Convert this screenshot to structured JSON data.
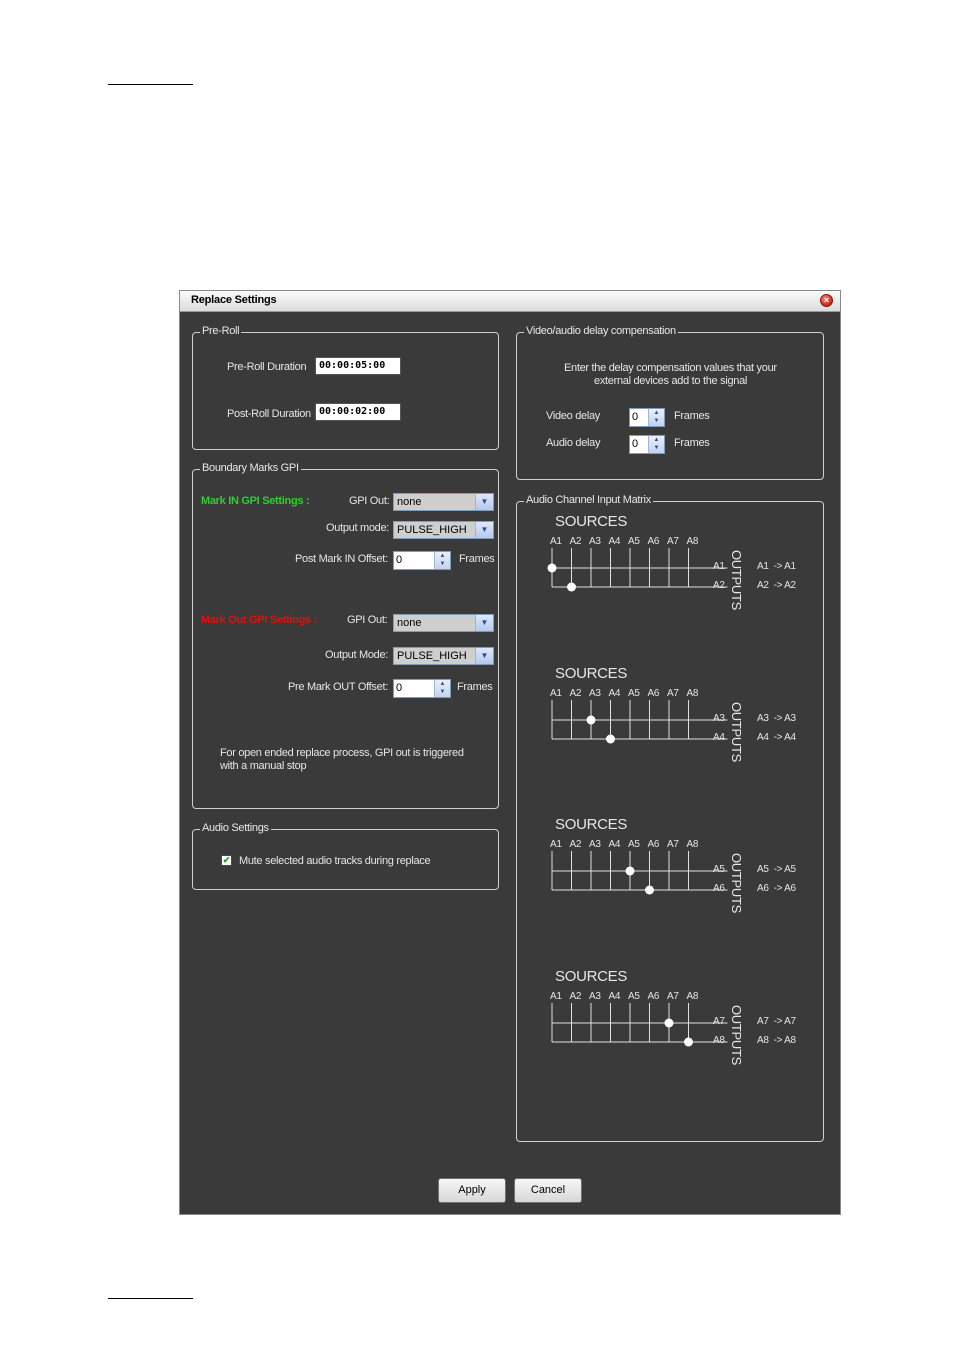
{
  "dialog": {
    "title": "Replace Settings"
  },
  "preroll": {
    "legend": "Pre-Roll",
    "preroll_label": "Pre-Roll Duration",
    "preroll_value": "00:00:05:00",
    "postroll_label": "Post-Roll Duration",
    "postroll_value": "00:00:02:00"
  },
  "boundary": {
    "legend": "Boundary Marks GPI",
    "mark_in": {
      "heading": "Mark IN GPI Settings :",
      "heading_color": "#33cc33",
      "gpi_out_label": "GPI Out:",
      "gpi_out_value": "none",
      "output_mode_label": "Output mode:",
      "output_mode_value": "PULSE_HIGH",
      "offset_label": "Post Mark IN Offset:",
      "offset_value": "0",
      "offset_unit": "Frames"
    },
    "mark_out": {
      "heading": "Mark Out GPI Settings :",
      "heading_color": "#e01010",
      "gpi_out_label": "GPI Out:",
      "gpi_out_value": "none",
      "output_mode_label": "Output Mode:",
      "output_mode_value": "PULSE_HIGH",
      "offset_label": "Pre Mark OUT Offset:",
      "offset_value": "0",
      "offset_unit": "Frames"
    },
    "note_line1": "For open ended replace process, GPI out is triggered",
    "note_line2": "with a manual stop"
  },
  "audio_settings": {
    "legend": "Audio Settings",
    "mute_label": "Mute selected audio tracks during replace",
    "mute_checked": true,
    "check_glyph": "✔"
  },
  "delay": {
    "legend": "Video/audio delay compensation",
    "desc_line1": "Enter the delay compensation values that your",
    "desc_line2": "external devices add to the signal",
    "video_label": "Video delay",
    "video_value": "0",
    "audio_label": "Audio delay",
    "audio_value": "0",
    "unit": "Frames"
  },
  "matrix": {
    "legend": "Audio Channel Input Matrix",
    "sources_title": "SOURCES",
    "outputs_title": "OUTPUTS",
    "source_labels": [
      "A1",
      "A2",
      "A3",
      "A4",
      "A5",
      "A6",
      "A7",
      "A8"
    ],
    "blocks": [
      {
        "outputs": [
          "A1",
          "A2"
        ],
        "routes": [
          "A1  -> A1",
          "A2  -> A2"
        ],
        "selected_source_index": [
          0,
          1
        ]
      },
      {
        "outputs": [
          "A3",
          "A4"
        ],
        "routes": [
          "A3  -> A3",
          "A4  -> A4"
        ],
        "selected_source_index": [
          2,
          3
        ]
      },
      {
        "outputs": [
          "A5",
          "A6"
        ],
        "routes": [
          "A5  -> A5",
          "A6  -> A6"
        ],
        "selected_source_index": [
          4,
          5
        ]
      },
      {
        "outputs": [
          "A7",
          "A8"
        ],
        "routes": [
          "A7  -> A7",
          "A8  -> A8"
        ],
        "selected_source_index": [
          6,
          7
        ]
      }
    ]
  },
  "footer": {
    "apply_label": "Apply",
    "cancel_label": "Cancel"
  }
}
